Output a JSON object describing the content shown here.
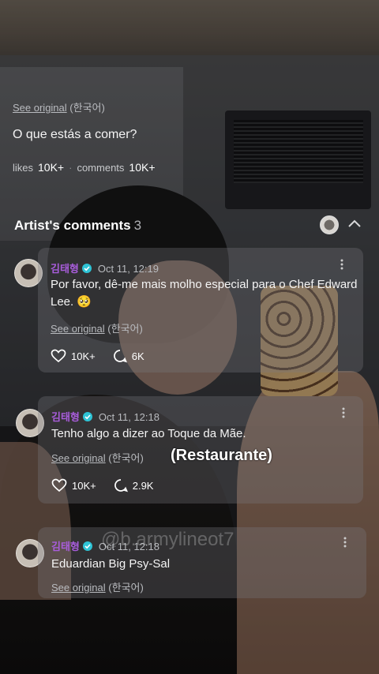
{
  "post": {
    "see_original": "See original",
    "see_original_lang": "(한국어)",
    "text": "O que estás a comer?",
    "likes_label": "likes",
    "likes_value": "10K+",
    "separator": "·",
    "comments_label": "comments",
    "comments_value": "10K+"
  },
  "section": {
    "title": "Artist's comments",
    "count": "3",
    "collapse_icon": "chevron-up-icon"
  },
  "comments": [
    {
      "author": "김태형",
      "time": "Oct 11, 12:19",
      "text": "Por favor, dê-me mais molho especial para o Chef Edward Lee. 🥺",
      "see_original": "See original",
      "see_original_lang": "(한국어)",
      "likes": "10K+",
      "replies": "6K"
    },
    {
      "author": "김태형",
      "time": "Oct 11, 12:18",
      "text": "Tenho algo a dizer ao Toque da Mãe.",
      "see_original": "See original",
      "see_original_lang": "(한국어)",
      "likes": "10K+",
      "replies": "2.9K"
    },
    {
      "author": "김태형",
      "time": "Oct 11, 12:18",
      "text": "Eduardian Big Psy-Sal",
      "see_original": "See original",
      "see_original_lang": "(한국어)"
    }
  ],
  "caption": "(Restaurante)",
  "watermark": "@b.armylineot7",
  "colors": {
    "author_name": "#a95ddc",
    "verified_badge": "#2ec4d6"
  }
}
